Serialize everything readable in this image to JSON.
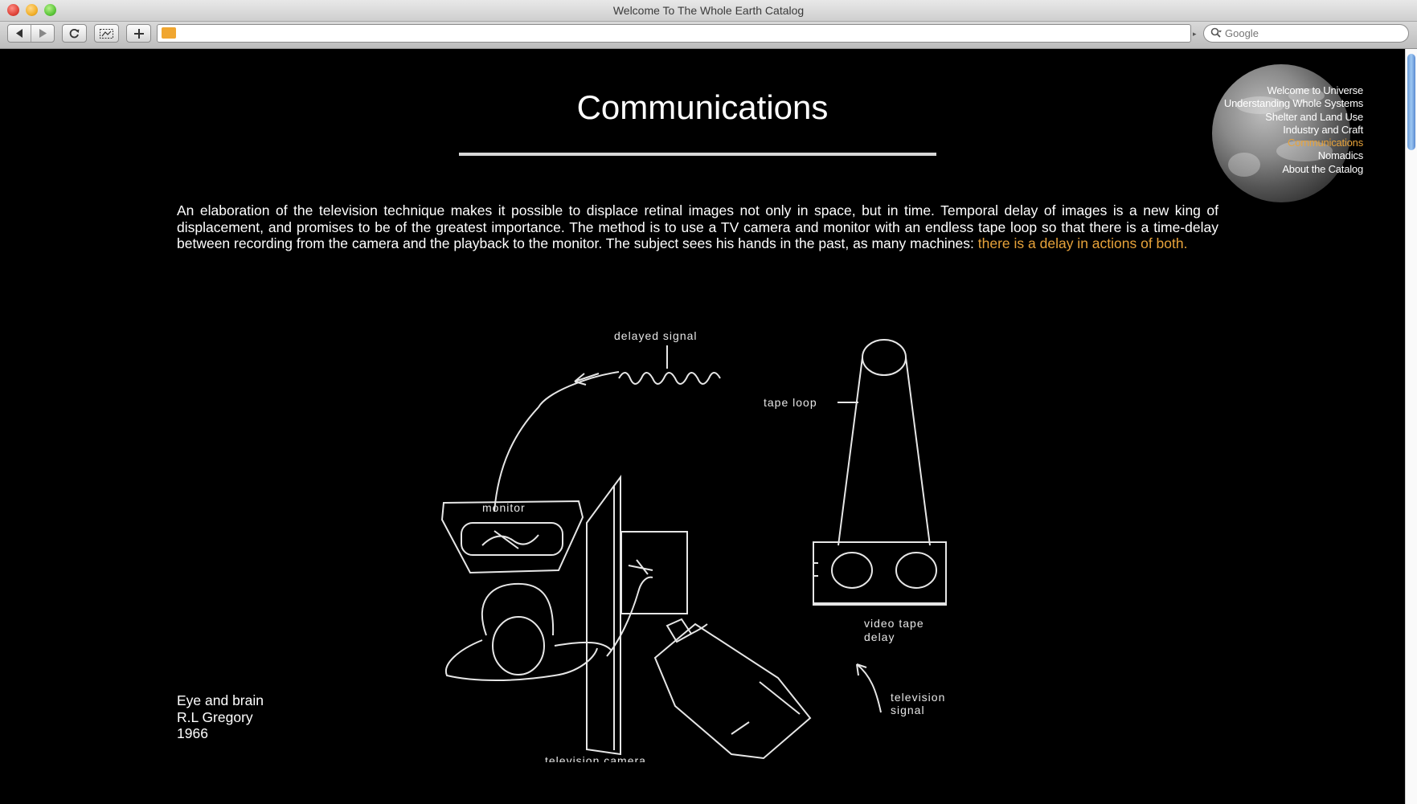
{
  "window": {
    "title": "Welcome To The Whole Earth Catalog"
  },
  "toolbar": {
    "back_icon": "back-arrow-icon",
    "forward_icon": "forward-arrow-icon",
    "reload_icon": "reload-icon",
    "snap_icon": "webclip-icon",
    "add_icon": "plus-icon",
    "url": "",
    "search_placeholder": "Google"
  },
  "page": {
    "title": "Communications",
    "paragraph_main": "An elaboration of the television technique makes it possible to displace retinal images not only in space, but in time. Temporal delay of images is a new king of displacement, and promises to be of the greatest importance. The method is to use a TV camera and monitor with an endless tape loop so that there is a time-delay between recording from the camera and the playback to the monitor. The subject sees his hands in the past, as many machines: ",
    "paragraph_highlight": "there is a delay in actions of both.",
    "highlight_color": "#e8a33a",
    "caption": {
      "line1": "Eye and brain",
      "line2": "R.L Gregory",
      "line3": "1966"
    }
  },
  "nav": {
    "items": [
      {
        "label": "Welcome to Universe",
        "active": false
      },
      {
        "label": "Understanding Whole Systems",
        "active": false
      },
      {
        "label": "Shelter and Land Use",
        "active": false
      },
      {
        "label": "Industry and Craft",
        "active": false
      },
      {
        "label": "Communications",
        "active": true
      },
      {
        "label": "Nomadics",
        "active": false
      },
      {
        "label": "About the Catalog",
        "active": false
      }
    ]
  },
  "figure": {
    "labels": {
      "delayed_signal": "delayed signal",
      "tape_loop": "tape loop",
      "monitor": "monitor",
      "video_tape_delay_1": "video tape",
      "video_tape_delay_2": "delay",
      "television_signal_1": "television",
      "television_signal_2": "signal",
      "television_camera": "television camera"
    }
  }
}
